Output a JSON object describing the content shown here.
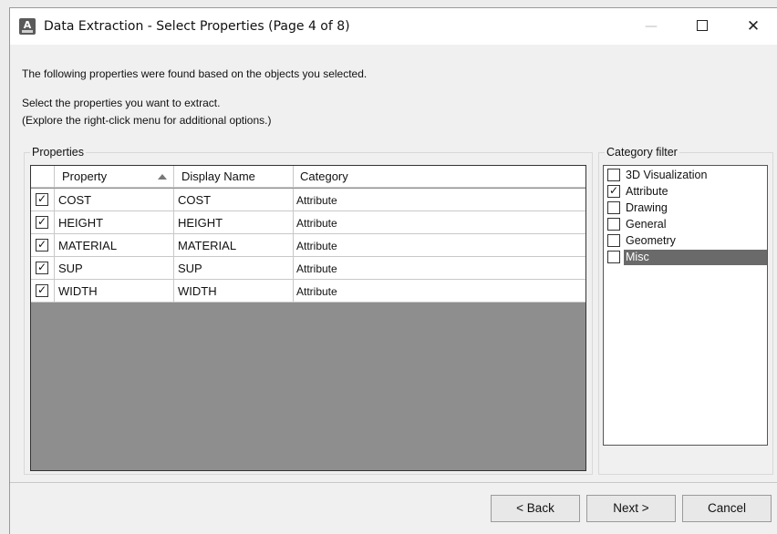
{
  "window": {
    "title": "Data Extraction - Select Properties (Page 4 of 8)",
    "controls": {
      "minimize": "—",
      "close": "✕"
    }
  },
  "intro": {
    "line1": "The following properties were found based on the objects you selected.",
    "line2": "Select the properties you want to extract.",
    "line3": "(Explore the right-click menu for additional options.)"
  },
  "properties": {
    "group_label": "Properties",
    "columns": [
      "Property",
      "Display Name",
      "Category"
    ],
    "sort": {
      "column": "Property",
      "direction": "ascending"
    },
    "rows": [
      {
        "checked": true,
        "property": "COST",
        "display_name": "COST",
        "category": "Attribute"
      },
      {
        "checked": true,
        "property": "HEIGHT",
        "display_name": "HEIGHT",
        "category": "Attribute"
      },
      {
        "checked": true,
        "property": "MATERIAL",
        "display_name": "MATERIAL",
        "category": "Attribute"
      },
      {
        "checked": true,
        "property": "SUP",
        "display_name": "SUP",
        "category": "Attribute"
      },
      {
        "checked": true,
        "property": "WIDTH",
        "display_name": "WIDTH",
        "category": "Attribute"
      }
    ]
  },
  "category_filter": {
    "label": "Category filter",
    "items": [
      {
        "label": "3D Visualization",
        "checked": false,
        "selected": false
      },
      {
        "label": "Attribute",
        "checked": true,
        "selected": false
      },
      {
        "label": "Drawing",
        "checked": false,
        "selected": false
      },
      {
        "label": "General",
        "checked": false,
        "selected": false
      },
      {
        "label": "Geometry",
        "checked": false,
        "selected": false
      },
      {
        "label": "Misc",
        "checked": false,
        "selected": true
      }
    ]
  },
  "buttons": {
    "back": "< Back",
    "next": "Next >",
    "cancel": "Cancel"
  },
  "colors": {
    "grid_empty_area": "#8e8e8e",
    "selection_highlight": "#6a6a6a"
  }
}
